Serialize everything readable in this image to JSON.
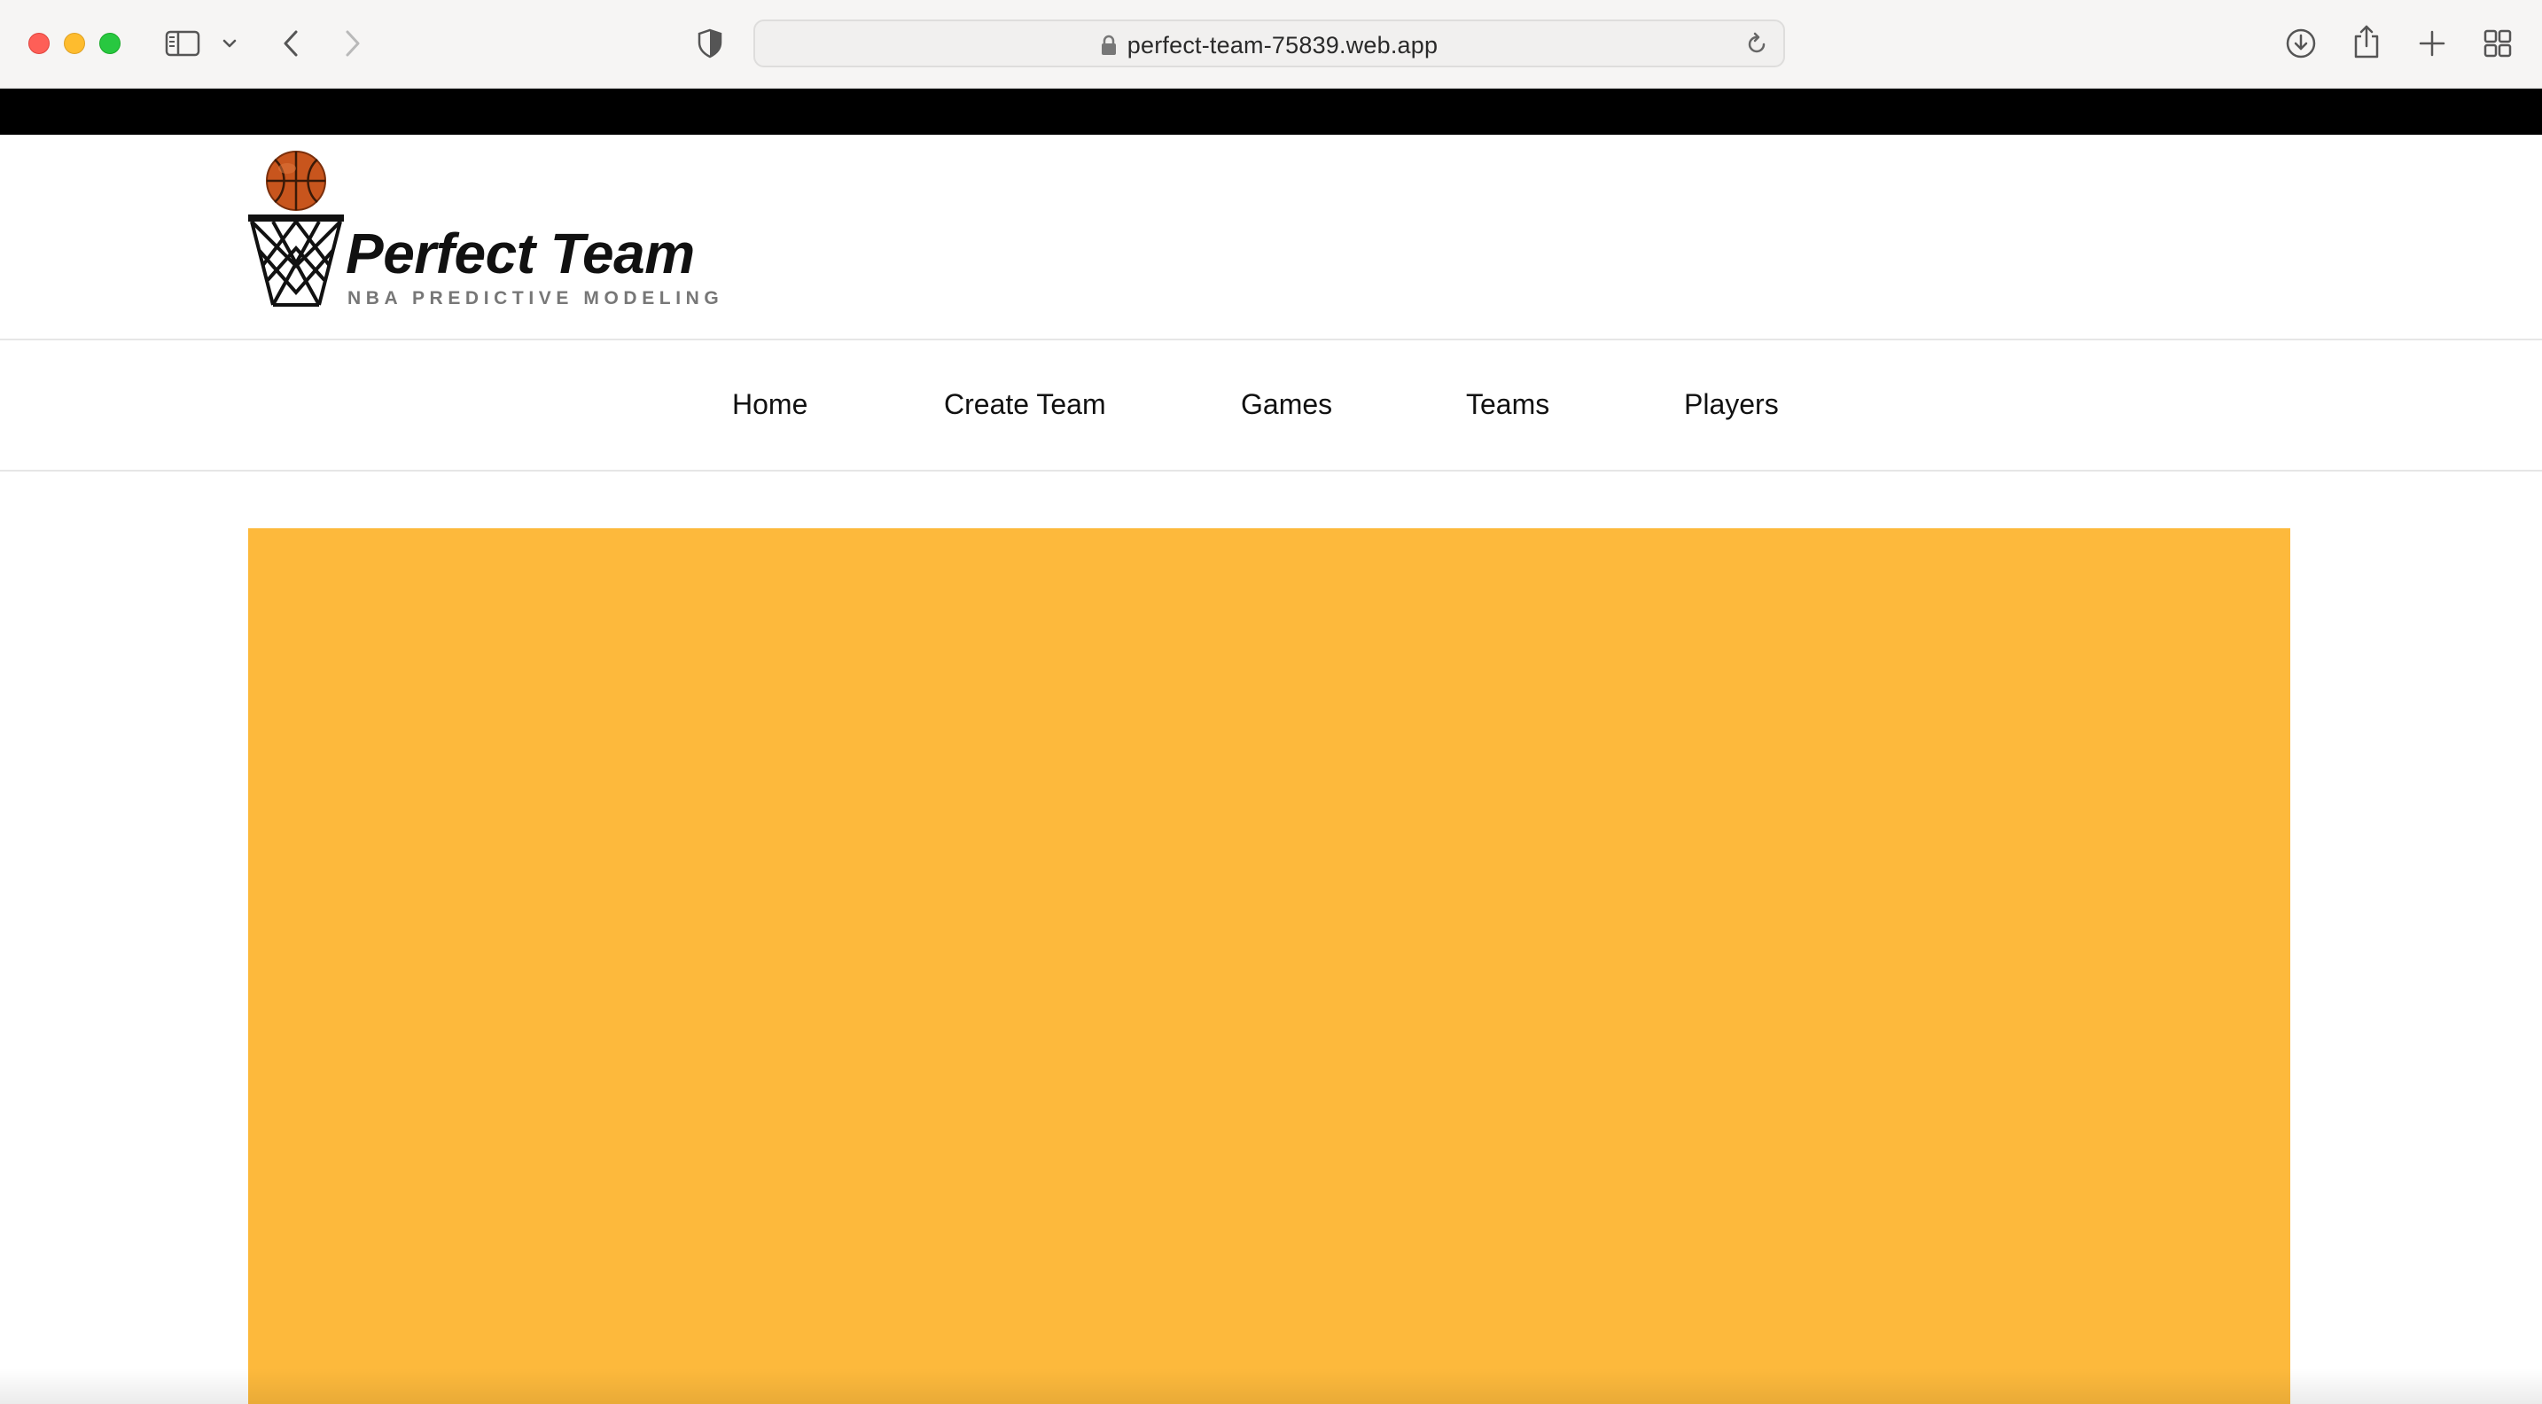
{
  "browser": {
    "url": "perfect-team-75839.web.app",
    "icons": [
      "sidebar-icon",
      "chevron-down-icon",
      "back-icon",
      "forward-icon",
      "shield-icon",
      "lock-icon",
      "reload-icon",
      "download-icon",
      "share-icon",
      "plus-icon",
      "tab-grid-icon"
    ]
  },
  "site": {
    "logo_title": "Perfect Team",
    "logo_subtitle": "NBA PREDICTIVE MODELING"
  },
  "nav": {
    "items": [
      "Home",
      "Create Team",
      "Games",
      "Teams",
      "Players"
    ]
  },
  "colors": {
    "hero": "#fdb93c",
    "topbar": "#000000",
    "basketball": "#c8551d"
  }
}
